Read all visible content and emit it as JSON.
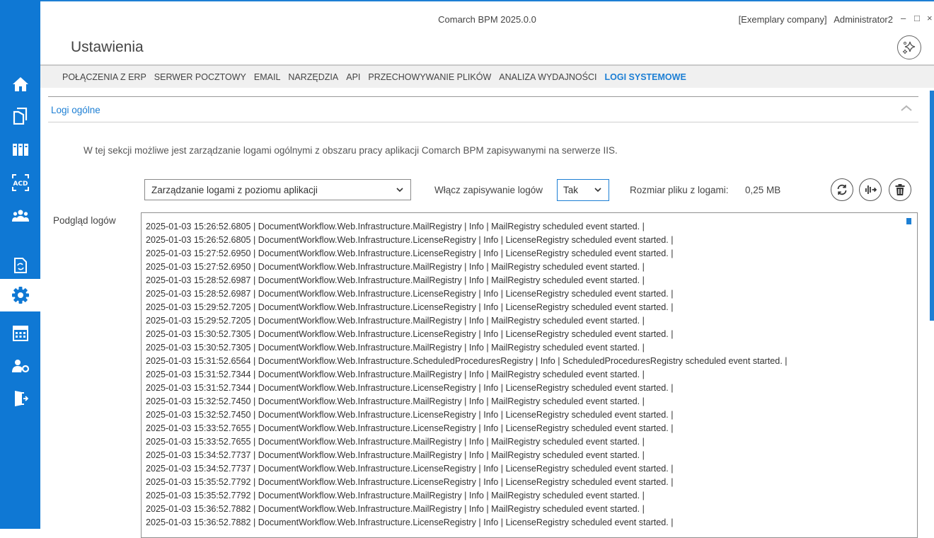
{
  "app": {
    "window_title": "Comarch BPM 2025.0.0",
    "company": "[Exemplary company]",
    "user": "Administrator2",
    "minimize": "–",
    "maximize": "□",
    "close": "×",
    "page_title": "Ustawienia"
  },
  "sidebar": {
    "accent_color": "#0f78d4",
    "items": [
      {
        "icon": "home-icon"
      },
      {
        "icon": "documents-icon"
      },
      {
        "icon": "binders-icon"
      },
      {
        "icon": "ocr-acd-icon"
      },
      {
        "icon": "users-icon"
      },
      {
        "icon": "document-sync-icon"
      },
      {
        "icon": "gear-icon",
        "active": true
      },
      {
        "icon": "calendar-icon"
      },
      {
        "icon": "user-settings-icon"
      },
      {
        "icon": "logout-icon"
      }
    ]
  },
  "tabs": [
    {
      "label": "POŁĄCZENIA Z ERP"
    },
    {
      "label": "SERWER POCZTOWY"
    },
    {
      "label": "EMAIL"
    },
    {
      "label": "NARZĘDZIA"
    },
    {
      "label": "API"
    },
    {
      "label": "PRZECHOWYWANIE PLIKÓW"
    },
    {
      "label": "ANALIZA WYDAJNOŚCI"
    },
    {
      "label": "LOGI SYSTEMOWE",
      "active": true
    }
  ],
  "section": {
    "title": "Logi ogólne",
    "description": "W tej sekcji możliwe jest zarządzanie logami ogólnymi z obszaru pracy aplikacji Comarch BPM zapisywanymi na serwerze IIS."
  },
  "controls": {
    "management_select": "Zarządzanie logami z poziomu aplikacji",
    "enable_logging_label": "Włącz zapisywanie logów",
    "enable_logging_value": "Tak",
    "file_size_label": "Rozmiar pliku z logami:",
    "file_size_value": "0,25 MB",
    "buttons": [
      "refresh-icon",
      "download-icon",
      "delete-icon"
    ]
  },
  "preview": {
    "label": "Podgląd logów",
    "lines": [
      "2025-01-03 15:26:52.6805 | DocumentWorkflow.Web.Infrastructure.MailRegistry | Info | MailRegistry scheduled event started. |",
      "2025-01-03 15:26:52.6805 | DocumentWorkflow.Web.Infrastructure.LicenseRegistry | Info | LicenseRegistry scheduled event started. |",
      "2025-01-03 15:27:52.6950 | DocumentWorkflow.Web.Infrastructure.LicenseRegistry | Info | LicenseRegistry scheduled event started. |",
      "2025-01-03 15:27:52.6950 | DocumentWorkflow.Web.Infrastructure.MailRegistry | Info | MailRegistry scheduled event started. |",
      "2025-01-03 15:28:52.6987 | DocumentWorkflow.Web.Infrastructure.MailRegistry | Info | MailRegistry scheduled event started. |",
      "2025-01-03 15:28:52.6987 | DocumentWorkflow.Web.Infrastructure.LicenseRegistry | Info | LicenseRegistry scheduled event started. |",
      "2025-01-03 15:29:52.7205 | DocumentWorkflow.Web.Infrastructure.LicenseRegistry | Info | LicenseRegistry scheduled event started. |",
      "2025-01-03 15:29:52.7205 | DocumentWorkflow.Web.Infrastructure.MailRegistry | Info | MailRegistry scheduled event started. |",
      "2025-01-03 15:30:52.7305 | DocumentWorkflow.Web.Infrastructure.LicenseRegistry | Info | LicenseRegistry scheduled event started. |",
      "2025-01-03 15:30:52.7305 | DocumentWorkflow.Web.Infrastructure.MailRegistry | Info | MailRegistry scheduled event started. |",
      "2025-01-03 15:31:52.6564 | DocumentWorkflow.Web.Infrastructure.ScheduledProceduresRegistry | Info | ScheduledProceduresRegistry scheduled event started. |",
      "2025-01-03 15:31:52.7344 | DocumentWorkflow.Web.Infrastructure.MailRegistry | Info | MailRegistry scheduled event started. |",
      "2025-01-03 15:31:52.7344 | DocumentWorkflow.Web.Infrastructure.LicenseRegistry | Info | LicenseRegistry scheduled event started. |",
      "2025-01-03 15:32:52.7450 | DocumentWorkflow.Web.Infrastructure.MailRegistry | Info | MailRegistry scheduled event started. |",
      "2025-01-03 15:32:52.7450 | DocumentWorkflow.Web.Infrastructure.LicenseRegistry | Info | LicenseRegistry scheduled event started. |",
      "2025-01-03 15:33:52.7655 | DocumentWorkflow.Web.Infrastructure.LicenseRegistry | Info | LicenseRegistry scheduled event started. |",
      "2025-01-03 15:33:52.7655 | DocumentWorkflow.Web.Infrastructure.MailRegistry | Info | MailRegistry scheduled event started. |",
      "2025-01-03 15:34:52.7737 | DocumentWorkflow.Web.Infrastructure.MailRegistry | Info | MailRegistry scheduled event started. |",
      "2025-01-03 15:34:52.7737 | DocumentWorkflow.Web.Infrastructure.LicenseRegistry | Info | LicenseRegistry scheduled event started. |",
      "2025-01-03 15:35:52.7792 | DocumentWorkflow.Web.Infrastructure.LicenseRegistry | Info | LicenseRegistry scheduled event started. |",
      "2025-01-03 15:35:52.7792 | DocumentWorkflow.Web.Infrastructure.MailRegistry | Info | MailRegistry scheduled event started. |",
      "2025-01-03 15:36:52.7882 | DocumentWorkflow.Web.Infrastructure.MailRegistry | Info | MailRegistry scheduled event started. |",
      "2025-01-03 15:36:52.7882 | DocumentWorkflow.Web.Infrastructure.LicenseRegistry | Info | LicenseRegistry scheduled event started. |"
    ]
  }
}
